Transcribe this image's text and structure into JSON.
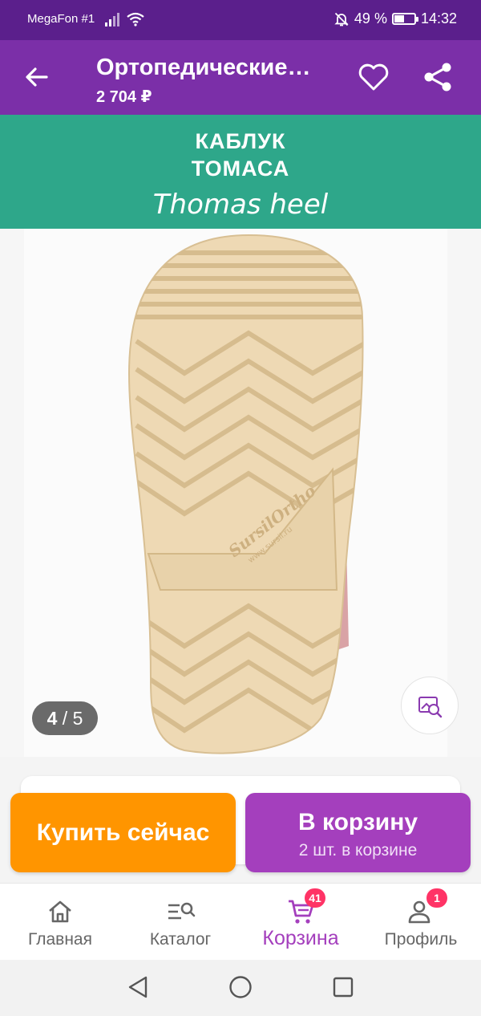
{
  "status_bar": {
    "carrier": "MegaFon #1",
    "battery_percent": "49 %",
    "battery_level": 0.49,
    "time": "14:32"
  },
  "header": {
    "title": "Ортопедические…",
    "price": "2 704 ₽",
    "back_icon": "arrow-left-icon",
    "favorite_icon": "heart-icon",
    "share_icon": "share-icon"
  },
  "gallery": {
    "banner_ru_line1": "КАБЛУК",
    "banner_ru_line2": "ТОМАСА",
    "banner_en": "Thomas heel",
    "current": "4",
    "separator": "/",
    "total": "5",
    "sole_brand": "SursilOrtho",
    "sole_site": "www.sursil.ru",
    "zoom_icon": "image-search-icon"
  },
  "actions": {
    "buy_now": "Купить сейчас",
    "add_to_cart": "В корзину",
    "in_cart": "2 шт. в корзине"
  },
  "colors": {
    "header": "#7b2fa8",
    "status_bar": "#5b1f8c",
    "banner": "#2ea78a",
    "buy_button": "#ff9500",
    "cart_button": "#a43fbd",
    "badge": "#ff3366"
  },
  "bottom_nav": {
    "home": "Главная",
    "catalog": "Каталог",
    "cart": "Корзина",
    "cart_badge": "41",
    "profile": "Профиль",
    "profile_badge": "1"
  }
}
